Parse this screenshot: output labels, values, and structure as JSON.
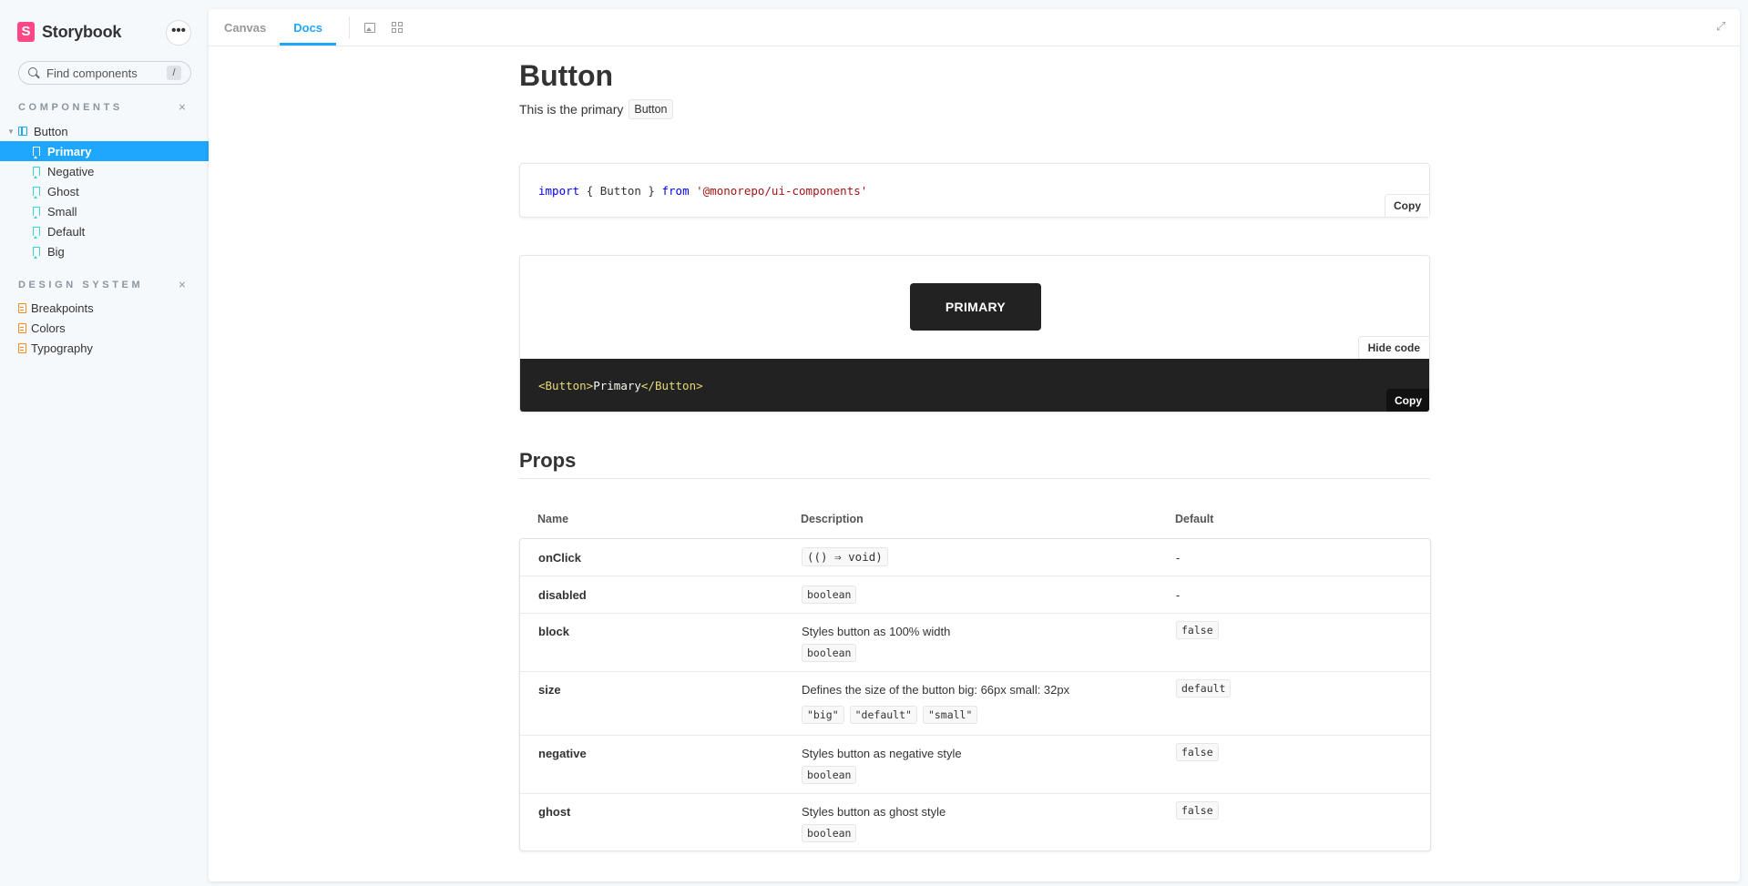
{
  "sidebar": {
    "brand": "Storybook",
    "brand_logo_letter": "S",
    "menu_button": "•••",
    "search": {
      "placeholder": "Find components",
      "shortcut": "/"
    },
    "sections": [
      {
        "title": "COMPONENTS",
        "group": "Button",
        "stories": [
          "Primary",
          "Negative",
          "Ghost",
          "Small",
          "Default",
          "Big"
        ],
        "active_story": "Primary"
      },
      {
        "title": "DESIGN SYSTEM",
        "docs": [
          "Breakpoints",
          "Colors",
          "Typography"
        ]
      }
    ],
    "collapse_glyph": "⨯"
  },
  "toolbar": {
    "tabs": [
      "Canvas",
      "Docs"
    ],
    "active_tab": "Docs",
    "expand_glyph": "⤢"
  },
  "docs": {
    "title": "Button",
    "subtitle_text": "This is the primary",
    "subtitle_code": "Button",
    "import": {
      "keyword_import": "import",
      "braces_open": "{ ",
      "name": "Button",
      "braces_close": " }",
      "keyword_from": "from",
      "module": "'@monorepo/ui-components'",
      "copy_label": "Copy"
    },
    "preview": {
      "button_label": "PRIMARY",
      "hide_code_label": "Hide code",
      "code_open_tag": "<Button>",
      "code_text": "Primary",
      "code_close_tag": "</Button>",
      "copy_label": "Copy"
    },
    "props": {
      "title": "Props",
      "headers": [
        "Name",
        "Description",
        "Default"
      ],
      "rows": [
        {
          "name": "onClick",
          "description": "",
          "types": [
            "(() ⇒ void)"
          ],
          "default": "-"
        },
        {
          "name": "disabled",
          "description": "",
          "types": [
            "boolean"
          ],
          "default": "-"
        },
        {
          "name": "block",
          "description": "Styles button as 100% width",
          "types": [
            "boolean"
          ],
          "default": "false"
        },
        {
          "name": "size",
          "description": "Defines the size of the button big: 66px small: 32px",
          "types": [
            "\"big\"",
            "\"default\"",
            "\"small\""
          ],
          "default": "default"
        },
        {
          "name": "negative",
          "description": "Styles button as negative style",
          "types": [
            "boolean"
          ],
          "default": "false"
        },
        {
          "name": "ghost",
          "description": "Styles button as ghost style",
          "types": [
            "boolean"
          ],
          "default": "false"
        }
      ]
    }
  },
  "colors": {
    "accent": "#1ea7fd",
    "brand": "#ff4785",
    "story_icon": "#37d5d3",
    "doc_icon": "#ff8a1e",
    "dark_code_bg": "#222222"
  }
}
